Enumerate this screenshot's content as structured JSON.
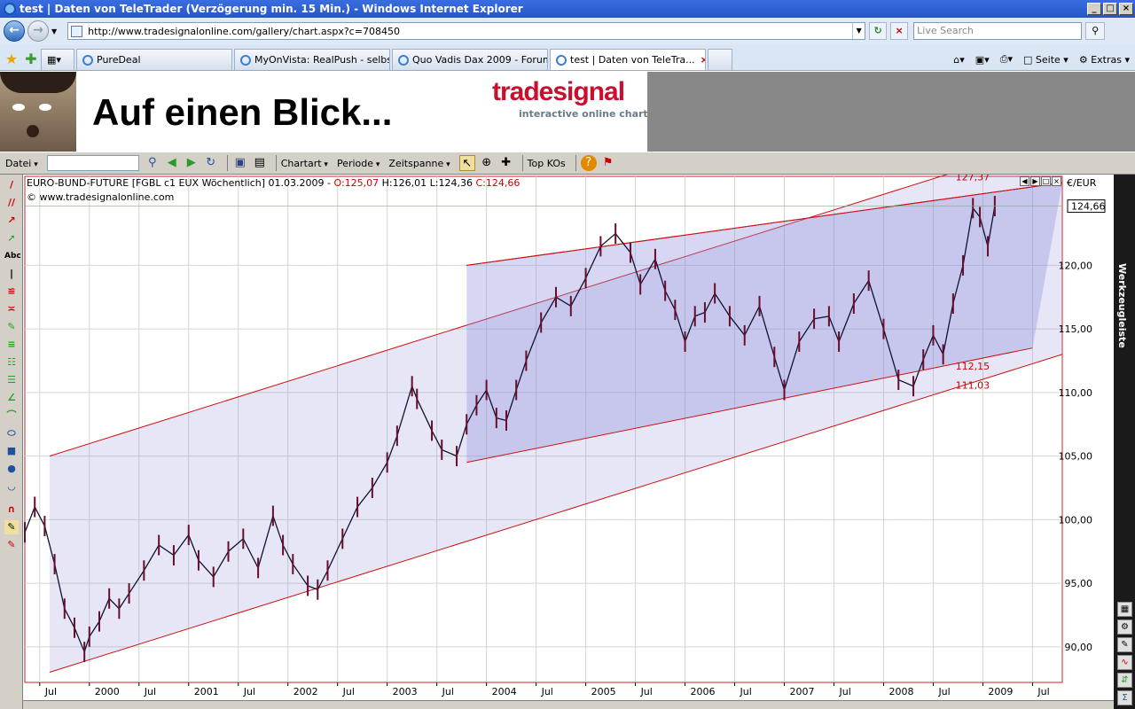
{
  "window": {
    "title": "test | Daten von TeleTrader (Verzögerung min. 15 Min.) - Windows Internet Explorer"
  },
  "address_bar": {
    "url": "http://www.tradesignalonline.com/gallery/chart.aspx?c=708450",
    "search_placeholder": "Live Search"
  },
  "tabs": [
    {
      "label": "PureDeal"
    },
    {
      "label": "MyOnVista: RealPush - selbs..."
    },
    {
      "label": "Quo Vadis Dax 2009 - Forum..."
    },
    {
      "label": "test | Daten von TeleTra..."
    }
  ],
  "command_bar": {
    "page_label": "Seite",
    "extras_label": "Extras"
  },
  "banner": {
    "slogan": "Auf einen Blick...",
    "logo": "tradesignal",
    "logo_sub": "interactive online charting"
  },
  "app_toolbar": {
    "file_menu": "Datei",
    "chart_type_menu": "Chartart",
    "period_menu": "Periode",
    "timespan_menu": "Zeitspanne",
    "top_kos": "Top KOs"
  },
  "chart_header": {
    "instrument": "EURO-BUND-FUTURE [FGBL c1 EUX  Wöchentlich] 01.03.2009 - ",
    "open": "O:125,07",
    "high": "H:126,01",
    "low": "L:124,36",
    "close": "C:124,66",
    "copyright": "© www.tradesignalonline.com",
    "currency": "€/EUR"
  },
  "right_toolbar": {
    "label": "Werkzeugleiste"
  },
  "chart_data": {
    "type": "line",
    "title": "",
    "xlabel": "",
    "ylabel": "",
    "x_tick_labels": [
      "Jul",
      "2000",
      "Jul",
      "2001",
      "Jul",
      "2002",
      "Jul",
      "2003",
      "Jul",
      "2004",
      "Jul",
      "2005",
      "Jul",
      "2006",
      "Jul",
      "2007",
      "Jul",
      "2008",
      "Jul",
      "2009",
      "Jul"
    ],
    "y_tick_labels": [
      "90,00",
      "95,00",
      "100,00",
      "105,00",
      "110,00",
      "115,00",
      "120,00"
    ],
    "y_ticks": [
      90,
      95,
      100,
      105,
      110,
      115,
      120
    ],
    "xlim": [
      1999.35,
      2009.8
    ],
    "ylim": [
      87.2,
      127.0
    ],
    "last_price_label": "124,66",
    "last_price": 124.66,
    "annotations": [
      {
        "text": "127,37"
      },
      {
        "text": "112,15"
      },
      {
        "text": "111,03"
      }
    ],
    "series": [
      {
        "x": [
          1999.35,
          1999.45,
          1999.55,
          1999.65,
          1999.75,
          1999.85,
          1999.95,
          2000.0,
          2000.1,
          2000.2,
          2000.3,
          2000.4,
          2000.55,
          2000.7,
          2000.85,
          2001.0,
          2001.1,
          2001.25,
          2001.4,
          2001.55,
          2001.7,
          2001.85,
          2001.95,
          2002.05,
          2002.2,
          2002.3,
          2002.4,
          2002.55,
          2002.7,
          2002.85,
          2003.0,
          2003.1,
          2003.25,
          2003.3,
          2003.45,
          2003.55,
          2003.7,
          2003.8,
          2003.9,
          2004.0,
          2004.1,
          2004.2,
          2004.3,
          2004.4,
          2004.55,
          2004.7,
          2004.85,
          2005.0,
          2005.15,
          2005.3,
          2005.45,
          2005.55,
          2005.7,
          2005.8,
          2005.9,
          2006.0,
          2006.1,
          2006.2,
          2006.3,
          2006.45,
          2006.6,
          2006.75,
          2006.9,
          2007.0,
          2007.15,
          2007.3,
          2007.45,
          2007.55,
          2007.7,
          2007.85,
          2008.0,
          2008.15,
          2008.3,
          2008.4,
          2008.5,
          2008.6,
          2008.7,
          2008.8,
          2008.9,
          2008.97,
          2009.05,
          2009.12
        ],
        "y": [
          99.0,
          101.0,
          99.5,
          96.5,
          93.0,
          91.5,
          89.6,
          90.8,
          92.0,
          93.8,
          93.0,
          94.2,
          96.0,
          98.0,
          97.2,
          98.8,
          96.8,
          95.5,
          97.5,
          98.5,
          96.2,
          100.3,
          98.0,
          96.5,
          94.8,
          94.5,
          96.0,
          98.5,
          101.0,
          102.5,
          104.5,
          106.6,
          110.5,
          109.5,
          107.0,
          105.5,
          105.0,
          107.5,
          109.0,
          110.2,
          108.0,
          107.8,
          110.2,
          112.5,
          115.5,
          117.5,
          116.8,
          119.0,
          121.5,
          122.5,
          121.0,
          118.5,
          120.5,
          118.0,
          116.5,
          114.0,
          116.0,
          116.3,
          117.8,
          116.0,
          114.5,
          116.8,
          112.8,
          110.2,
          114.0,
          115.8,
          116.0,
          114.0,
          117.0,
          118.8,
          115.0,
          111.0,
          110.5,
          112.6,
          114.5,
          113.0,
          117.0,
          120.0,
          124.5,
          123.8,
          121.5,
          124.66
        ]
      }
    ],
    "channels": [
      {
        "name": "",
        "lines": [
          [
            1999.6,
            105.0,
            2009.8,
            130.0
          ],
          [
            1999.6,
            88.0,
            2009.8,
            113.0
          ]
        ]
      },
      {
        "name": "",
        "lines": [
          [
            2003.8,
            120.0,
            2009.8,
            126.5
          ],
          [
            2003.8,
            104.5,
            2009.5,
            113.5
          ]
        ]
      }
    ],
    "grid": true
  }
}
